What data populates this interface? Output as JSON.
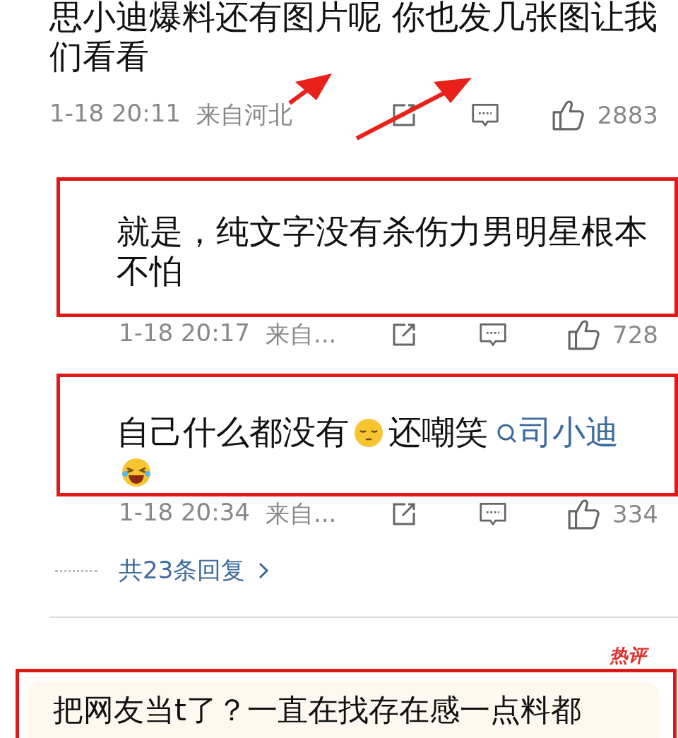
{
  "comment": {
    "text": "思小迪爆料还有图片呢 你也发几张图让我们看看",
    "time": "1-18 20:11",
    "location": "来自河北",
    "likes": "2883",
    "arrows": true
  },
  "replies": [
    {
      "highlighted": true,
      "segments": [
        {
          "kind": "text",
          "text": "就是，纯文字没有杀伤力男明星根本不怕"
        }
      ],
      "time": "1-18 20:17",
      "location": "来自...",
      "likes": "728"
    },
    {
      "highlighted": true,
      "segments": [
        {
          "kind": "text",
          "text": "自己什么都没有"
        },
        {
          "kind": "emoji_sleepy"
        },
        {
          "kind": "text",
          "text": "还嘲笑"
        },
        {
          "kind": "mention",
          "text": "司小迪"
        },
        {
          "kind": "emoji_laugh"
        }
      ],
      "time": "1-18 20:34",
      "location": "来自...",
      "likes": "334"
    }
  ],
  "more_replies": "共23条回复",
  "next_comment": {
    "badge": "热评",
    "text": "把网友当t了？一直在找存在感一点料都",
    "highlighted": true
  }
}
